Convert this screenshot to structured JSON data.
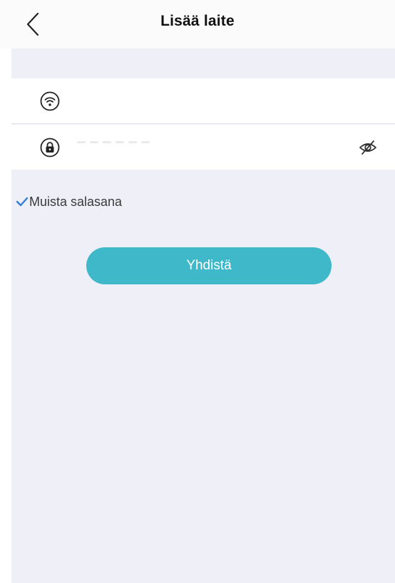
{
  "header": {
    "title": "Lisää laite",
    "back_icon": "chevron-left-icon"
  },
  "ssid_field": {
    "icon": "wifi-icon",
    "value": "",
    "placeholder": ""
  },
  "password_field": {
    "icon": "lock-icon",
    "value": "",
    "placeholder": "",
    "toggle_icon": "eye-off-icon"
  },
  "remember": {
    "checked": true,
    "label": "Muista salasana"
  },
  "connect_button": {
    "label": "Yhdistä"
  },
  "colors": {
    "accent": "#3fb8c9",
    "background": "#efeff7",
    "checkmark": "#2f7fd8"
  }
}
